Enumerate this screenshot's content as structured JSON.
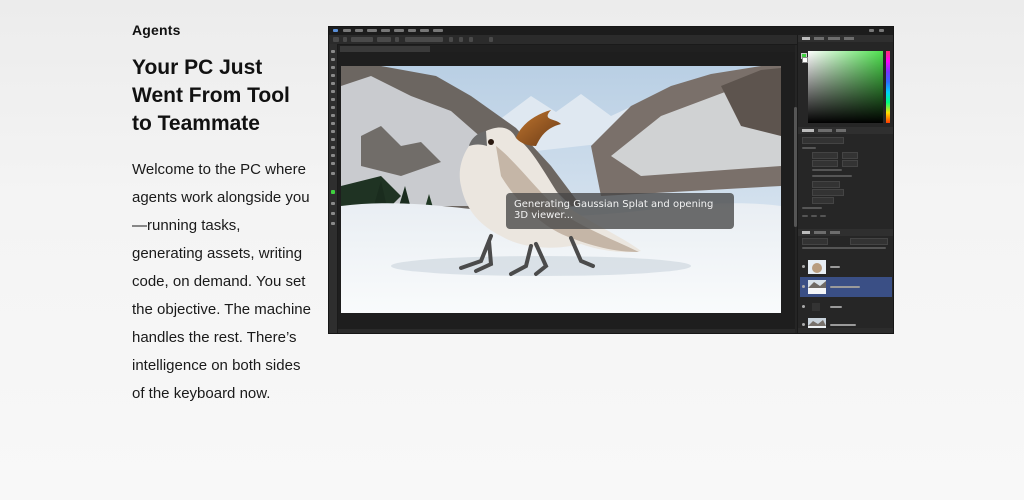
{
  "section": {
    "eyebrow": "Agents",
    "headline": "Your PC Just Went From Tool to Teammate",
    "body": "Welcome to the PC where agents work alongside you—running tasks, generating assets, writing code, on demand. You set the objective. The machine handles the rest. There’s intelligence on both sides of the keyboard now."
  },
  "screenshot": {
    "app": "image-editor",
    "toast_message": "Generating Gaussian Splat and opening 3D viewer...",
    "colors": {
      "foreground_swatch": "#3fd13f",
      "selected_layer": "#3a4f85",
      "ui_background": "#252525"
    },
    "icons": [
      "hue-slider",
      "color-picker-field",
      "eye-icon"
    ]
  }
}
